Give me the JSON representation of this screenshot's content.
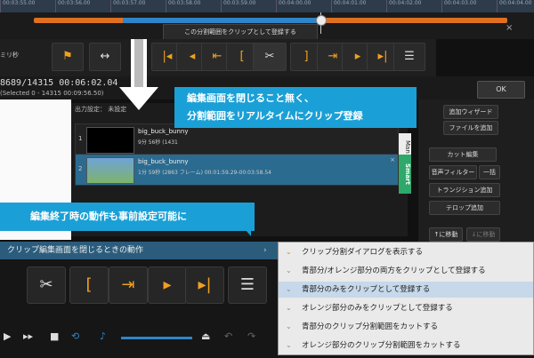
{
  "timeline": {
    "ticks": [
      "00:03:55.00",
      "00:03:56.00",
      "00:03:57.00",
      "00:03:58.00",
      "00:03:59.00",
      "00:04:00.00",
      "00:04:01.00",
      "00:04:02.00",
      "00:04:03.00",
      "00:04:04.00"
    ]
  },
  "editor": {
    "tooltip": "この分割範囲をクリップとして登録する",
    "ms_label": "ミリ秒",
    "frame_text": "8689/14315 00:06:02.04",
    "selected_text": "(Selected 0 - 14315 00:09:56.50)",
    "ok_label": "OK",
    "toolbar_icons": [
      "flag-icon",
      "move-icon",
      "trim-start-icon",
      "prev-frame-icon",
      "go-start-icon",
      "bracket-open-icon",
      "scissors-icon",
      "bracket-close-icon",
      "next-frame-icon",
      "go-end-icon",
      "menu-icon"
    ]
  },
  "clips": {
    "header": "出力設定： 未設定",
    "items": [
      {
        "num": "1",
        "name": "big_buck_bunny",
        "info": "9分 56秒 (1431"
      },
      {
        "num": "2",
        "name": "big_buck_bunny",
        "info": "1分 59秒 (2863 フレーム)  00:01:59.29-00:03:58.54",
        "close": "×"
      }
    ],
    "tab_man": "Man",
    "tab_smart": "Smart"
  },
  "right_panel": {
    "buttons": [
      "追加ウィザード",
      "ファイルを追加",
      "カット編集",
      "音声フィルター",
      "一括",
      "トランジション追加",
      "テロップ追加",
      "↑に移動",
      "↓に移動"
    ]
  },
  "callouts": {
    "line1": "編集画面を閉じること無く、",
    "line2": "分割範囲をリアルタイムにクリップ登録",
    "line3": "編集終了時の動作も事前設定可能に"
  },
  "bottom": {
    "menu_label": "クリップ編集画面を閉じるときの動作",
    "menu_arrow": "›"
  },
  "dropdown": {
    "items": [
      "クリップ分割ダイアログを表示する",
      "青部分/オレンジ部分の両方をクリップとして登録する",
      "青部分のみをクリップとして登録する",
      "オレンジ部分のみをクリップとして登録する",
      "青部分のクリップ分割範囲をカットする",
      "オレンジ部分のクリップ分割範囲をカットする"
    ],
    "selected_index": 2
  },
  "colors": {
    "accent_blue": "#1aa0d6",
    "orange": "#e07020",
    "seek_blue": "#2f85c8",
    "smart_green": "#2fa86b"
  }
}
